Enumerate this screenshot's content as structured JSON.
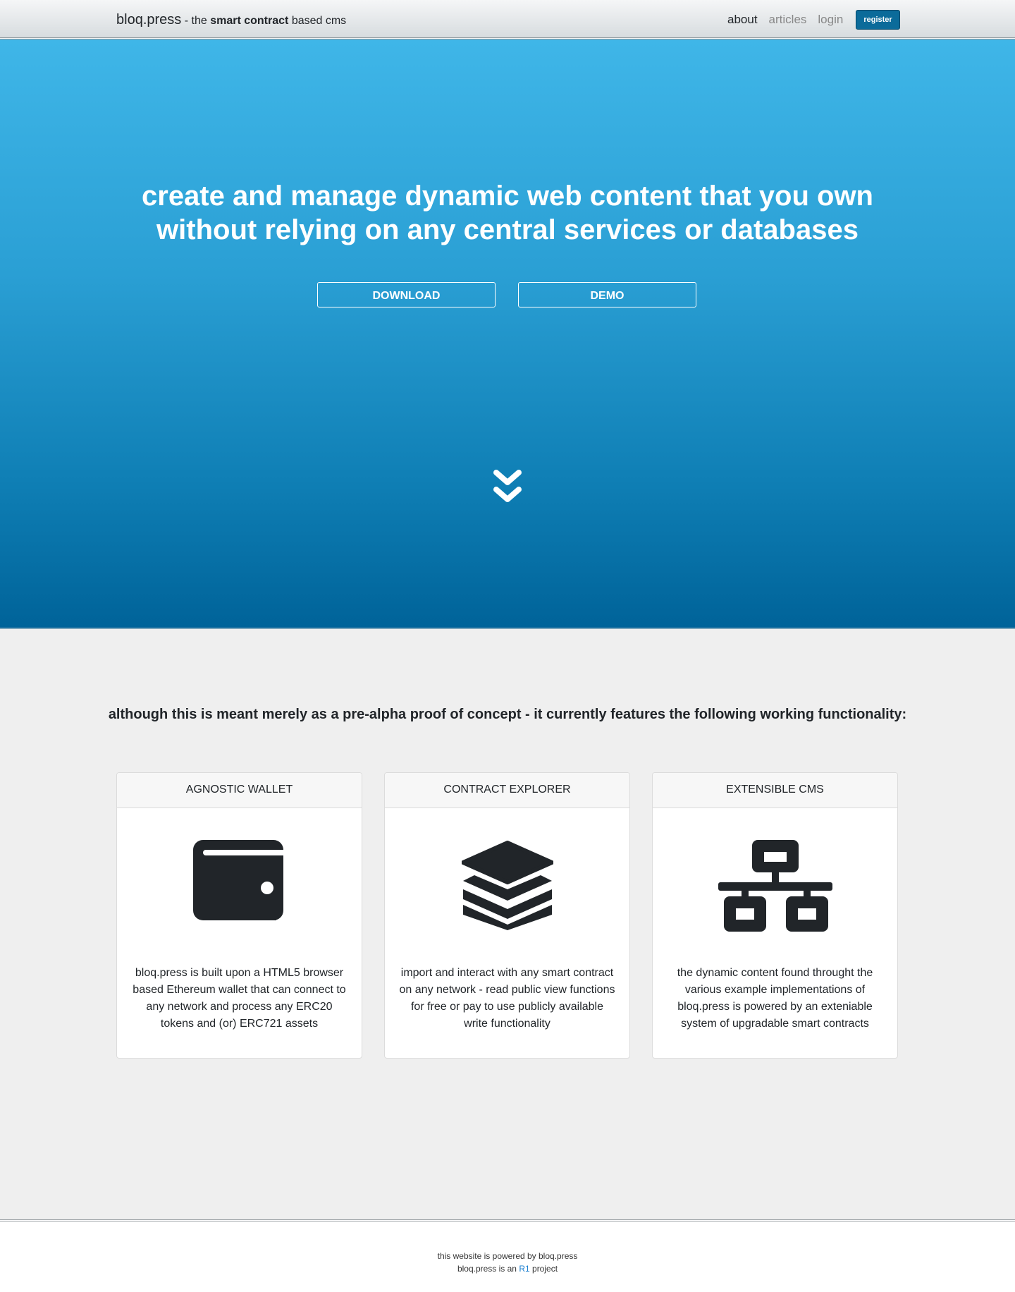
{
  "navbar": {
    "brand_name": "bloq.press",
    "brand_prefix": "- the",
    "brand_strong": "smart contract",
    "brand_suffix": "based cms",
    "links": [
      {
        "label": "about"
      },
      {
        "label": "articles"
      },
      {
        "label": "login"
      }
    ],
    "register_label": "register"
  },
  "hero": {
    "title_line1": "create and manage dynamic web content that you own",
    "title_line2": "without relying on any central services or databases",
    "download_label": "DOWNLOAD",
    "demo_label": "DEMO",
    "scroll_icon": "double-chevron-down-icon"
  },
  "features": {
    "intro": "although this is meant merely as a pre-alpha proof of concept - it currently features the following working functionality:",
    "cards": [
      {
        "title": "AGNOSTIC WALLET",
        "icon": "wallet-icon",
        "text": "bloq.press is built upon a HTML5 browser based Ethereum wallet that can connect to any network and process any ERC20 tokens and (or) ERC721 assets"
      },
      {
        "title": "CONTRACT EXPLORER",
        "icon": "layers-icon",
        "text": "import and interact with any smart contract on any network - read public view functions for free or pay to use publicly available write functionality"
      },
      {
        "title": "EXTENSIBLE CMS",
        "icon": "network-icon",
        "text": "the dynamic content found throught the various example implementations of bloq.press is powered by an exteniable system of upgradable smart contracts"
      }
    ]
  },
  "footer": {
    "line1": "this website is powered by bloq.press",
    "line2_prefix": "bloq.press is an",
    "line2_link": "R1",
    "line2_suffix": "project"
  },
  "colors": {
    "hero_top": "#3fb6e8",
    "hero_bottom": "#006399",
    "register_bg": "#0b6b9a",
    "link_blue": "#1a7fd0",
    "icon_dark": "#212529"
  }
}
